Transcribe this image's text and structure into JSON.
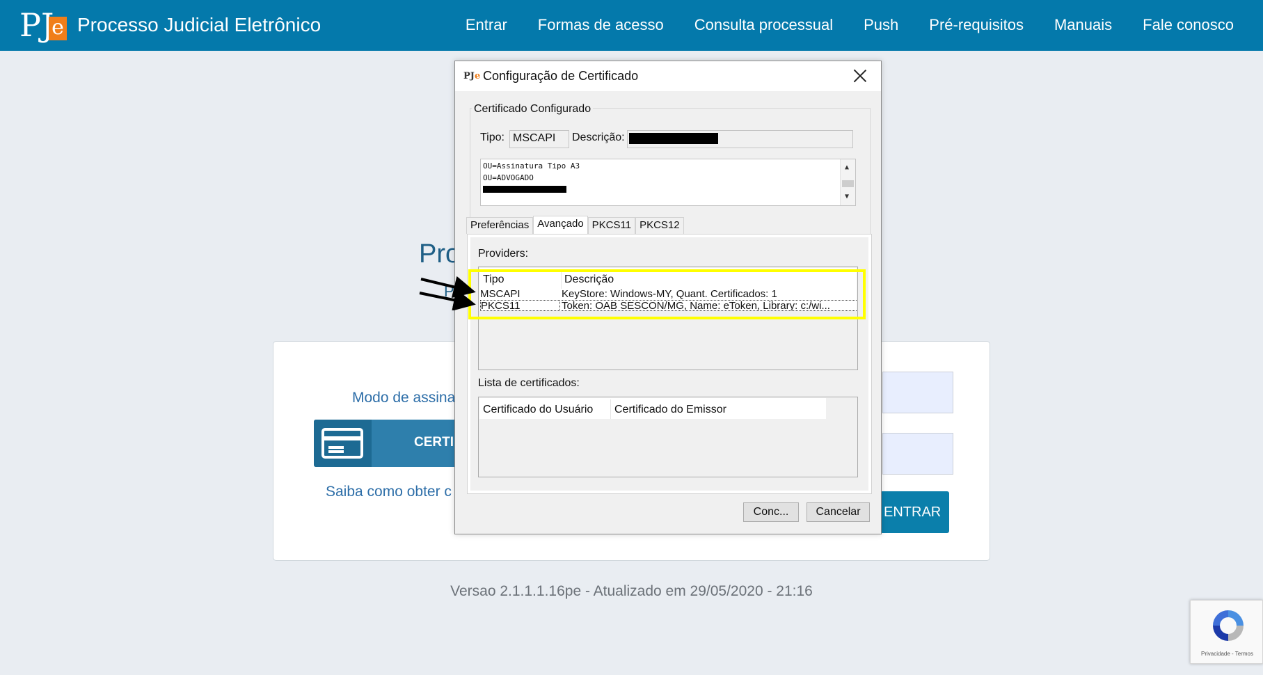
{
  "navbar": {
    "logo": {
      "p": "P",
      "j": "J",
      "e": "e"
    },
    "brand": "Processo Judicial Eletrônico",
    "links": [
      "Entrar",
      "Formas de acesso",
      "Consulta processual",
      "Push",
      "Pré-requisitos",
      "Manuais",
      "Fale conosco"
    ]
  },
  "background": {
    "title_partial": "Pro",
    "subtitle_partial": "P",
    "mode_label_partial": "Modo de assina",
    "cert_button_partial": "CERTIF",
    "help_link_partial": "Saiba como obter c",
    "entrar_button": "ENTRAR",
    "version": "Versao 2.1.1.1.16pe - Atualizado em 29/05/2020 - 21:16",
    "recaptcha_text": "Privacidade - Termos"
  },
  "dialog": {
    "icon": {
      "pj": "PJ",
      "e": "e"
    },
    "title": "Configuração de Certificado",
    "configured_group": "Certificado Configurado",
    "tipo_label": "Tipo:",
    "tipo_value": "MSCAPI",
    "descricao_label": "Descrição:",
    "details_lines": [
      "OU=Assinatura Tipo A3",
      "OU=ADVOGADO"
    ],
    "tabs": [
      {
        "label": "Preferências",
        "active": false
      },
      {
        "label": "Avançado",
        "active": true
      },
      {
        "label": "PKCS11",
        "active": false
      },
      {
        "label": "PKCS12",
        "active": false
      }
    ],
    "providers_label": "Providers:",
    "providers_headers": [
      "Tipo",
      "Descrição"
    ],
    "providers_rows": [
      {
        "tipo": "MSCAPI",
        "descricao": "KeyStore: Windows-MY, Quant. Certificados: 1"
      },
      {
        "tipo": "PKCS11",
        "descricao": "Token: OAB SESCON/MG, Name: eToken, Library: c:/wi..."
      }
    ],
    "list_label": "Lista de certificados:",
    "list_headers": [
      "Certificado do Usuário",
      "Certificado do Emissor"
    ],
    "ok_button": "Conc...",
    "cancel_button": "Cancelar"
  },
  "colors": {
    "navbar": "#0479ab",
    "logo_accent": "#f07e1a",
    "highlight": "#ffff00",
    "page_bg": "#e9edf2"
  }
}
